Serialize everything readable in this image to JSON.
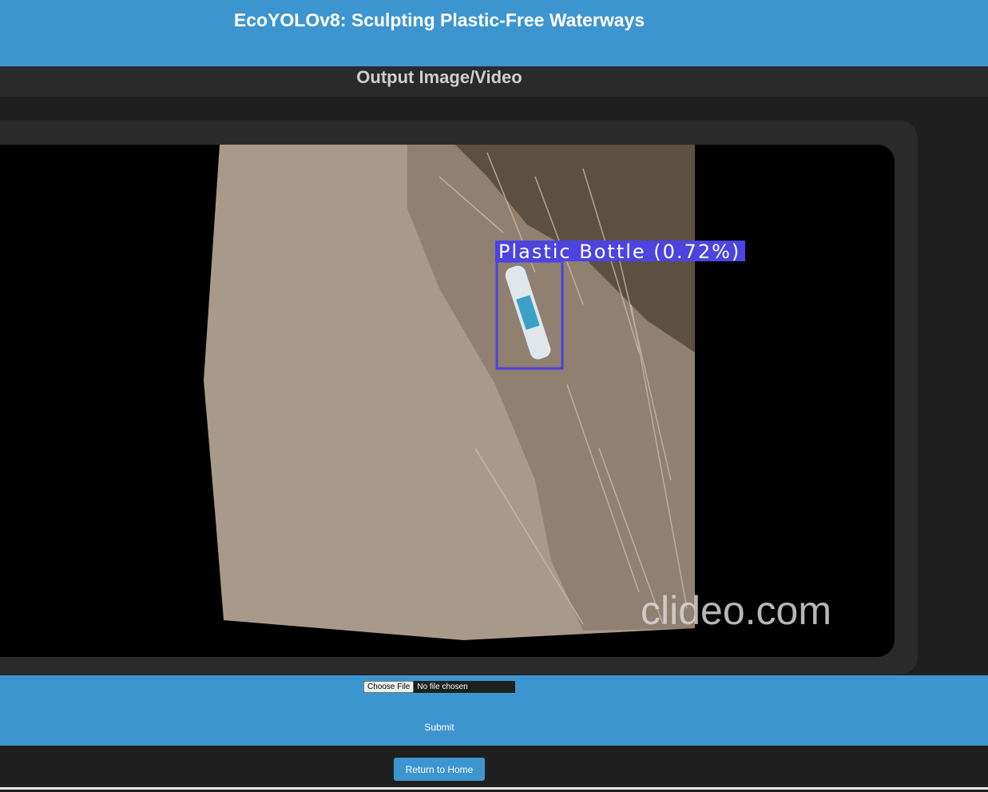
{
  "header": {
    "title": "EcoYOLOv8: Sculpting Plastic-Free Waterways"
  },
  "section": {
    "title": "Output Image/Video"
  },
  "output": {
    "detection_label": "Plastic Bottle (0.72%)",
    "watermark": "clideo.com",
    "box_color": "#4b44e0"
  },
  "upload": {
    "choose_label": "Choose File",
    "file_status": "No file chosen",
    "submit_label": "Submit"
  },
  "footer": {
    "home_label": "Return to Home"
  },
  "colors": {
    "accent": "#3d95cf",
    "background": "#1f1f1f"
  }
}
